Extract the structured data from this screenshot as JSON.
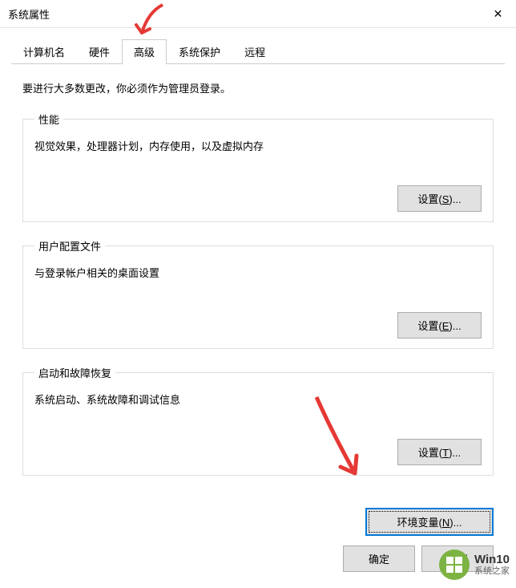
{
  "window": {
    "title": "系统属性"
  },
  "tabs": {
    "computer_name": "计算机名",
    "hardware": "硬件",
    "advanced": "高级",
    "system_protection": "系统保护",
    "remote": "远程"
  },
  "content": {
    "admin_note": "要进行大多数更改，你必须作为管理员登录。",
    "performance": {
      "legend": "性能",
      "desc": "视觉效果，处理器计划，内存使用，以及虚拟内存",
      "button": "设置(S)..."
    },
    "user_profiles": {
      "legend": "用户配置文件",
      "desc": "与登录帐户相关的桌面设置",
      "button": "设置(E)..."
    },
    "startup_recovery": {
      "legend": "启动和故障恢复",
      "desc": "系统启动、系统故障和调试信息",
      "button": "设置(T)..."
    },
    "env_var_button": "环境变量(N)..."
  },
  "buttons": {
    "ok": "确定",
    "cancel": "取消"
  },
  "watermark": {
    "brand": "Win10",
    "site": "系统之家"
  }
}
